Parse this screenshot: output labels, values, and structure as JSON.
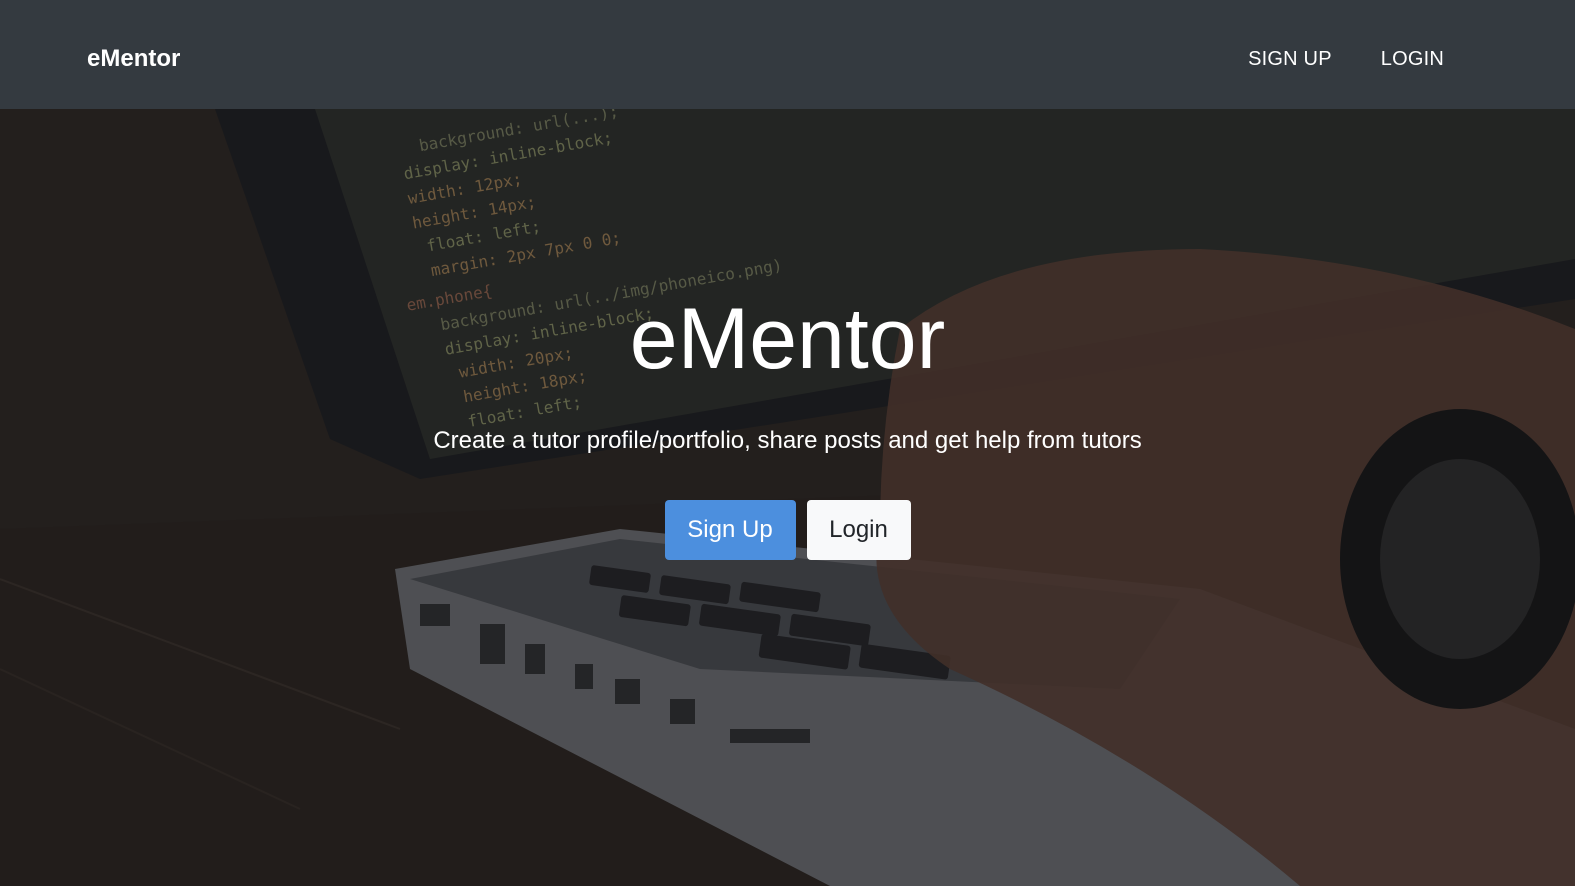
{
  "navbar": {
    "brand": "eMentor",
    "links": {
      "signup": "SIGN UP",
      "login": "LOGIN"
    }
  },
  "hero": {
    "title": "eMentor",
    "subtitle": "Create a tutor profile/portfolio, share posts and get help from tutors",
    "buttons": {
      "signup": "Sign Up",
      "login": "Login"
    },
    "background_image": "laptop-with-code-editor-and-hand-typing"
  },
  "colors": {
    "navbar_bg": "#343a40",
    "primary_button": "#4c8fde",
    "light_button": "#f8f9fa"
  }
}
